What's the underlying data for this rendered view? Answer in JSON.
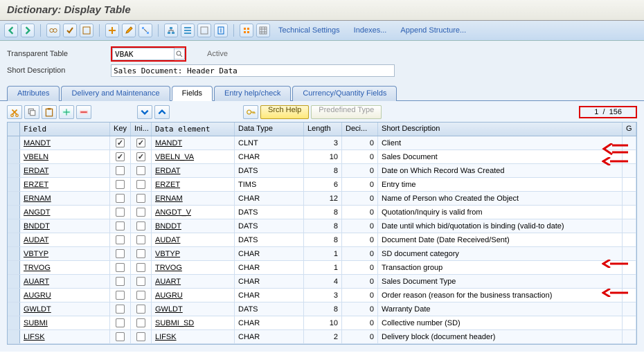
{
  "titlebar": "Dictionary: Display Table",
  "toolbar": {
    "tech_settings": "Technical Settings",
    "indexes": "Indexes...",
    "append": "Append Structure..."
  },
  "form": {
    "table_label": "Transparent Table",
    "table_value": "VBAK",
    "status": "Active",
    "desc_label": "Short Description",
    "desc_value": "Sales Document: Header Data"
  },
  "tabs": {
    "attributes": "Attributes",
    "delivery": "Delivery and Maintenance",
    "fields": "Fields",
    "entry": "Entry help/check",
    "currency": "Currency/Quantity Fields"
  },
  "gridbar": {
    "srch": "Srch Help",
    "pred": "Predefined Type",
    "page_cur": "1",
    "page_sep": "/",
    "page_total": "156"
  },
  "headers": {
    "field": "Field",
    "key": "Key",
    "ini": "Ini...",
    "de": "Data element",
    "dt": "Data Type",
    "len": "Length",
    "dec": "Deci...",
    "desc": "Short Description",
    "g": "G"
  },
  "rows": [
    {
      "field": "MANDT",
      "key": true,
      "ini": true,
      "de": "MANDT",
      "dt": "CLNT",
      "len": "3",
      "dec": "0",
      "desc": "Client"
    },
    {
      "field": "VBELN",
      "key": true,
      "ini": true,
      "de": "VBELN_VA",
      "dt": "CHAR",
      "len": "10",
      "dec": "0",
      "desc": "Sales Document"
    },
    {
      "field": "ERDAT",
      "key": false,
      "ini": false,
      "de": "ERDAT",
      "dt": "DATS",
      "len": "8",
      "dec": "0",
      "desc": "Date on Which Record Was Created"
    },
    {
      "field": "ERZET",
      "key": false,
      "ini": false,
      "de": "ERZET",
      "dt": "TIMS",
      "len": "6",
      "dec": "0",
      "desc": "Entry time"
    },
    {
      "field": "ERNAM",
      "key": false,
      "ini": false,
      "de": "ERNAM",
      "dt": "CHAR",
      "len": "12",
      "dec": "0",
      "desc": "Name of Person who Created the Object"
    },
    {
      "field": "ANGDT",
      "key": false,
      "ini": false,
      "de": "ANGDT_V",
      "dt": "DATS",
      "len": "8",
      "dec": "0",
      "desc": "Quotation/Inquiry is valid from"
    },
    {
      "field": "BNDDT",
      "key": false,
      "ini": false,
      "de": "BNDDT",
      "dt": "DATS",
      "len": "8",
      "dec": "0",
      "desc": "Date until which bid/quotation is binding (valid-to date)"
    },
    {
      "field": "AUDAT",
      "key": false,
      "ini": false,
      "de": "AUDAT",
      "dt": "DATS",
      "len": "8",
      "dec": "0",
      "desc": "Document Date (Date Received/Sent)"
    },
    {
      "field": "VBTYP",
      "key": false,
      "ini": false,
      "de": "VBTYP",
      "dt": "CHAR",
      "len": "1",
      "dec": "0",
      "desc": "SD document category"
    },
    {
      "field": "TRVOG",
      "key": false,
      "ini": false,
      "de": "TRVOG",
      "dt": "CHAR",
      "len": "1",
      "dec": "0",
      "desc": "Transaction group"
    },
    {
      "field": "AUART",
      "key": false,
      "ini": false,
      "de": "AUART",
      "dt": "CHAR",
      "len": "4",
      "dec": "0",
      "desc": "Sales Document Type"
    },
    {
      "field": "AUGRU",
      "key": false,
      "ini": false,
      "de": "AUGRU",
      "dt": "CHAR",
      "len": "3",
      "dec": "0",
      "desc": "Order reason (reason for the business transaction)"
    },
    {
      "field": "GWLDT",
      "key": false,
      "ini": false,
      "de": "GWLDT",
      "dt": "DATS",
      "len": "8",
      "dec": "0",
      "desc": "Warranty Date"
    },
    {
      "field": "SUBMI",
      "key": false,
      "ini": false,
      "de": "SUBMI_SD",
      "dt": "CHAR",
      "len": "10",
      "dec": "0",
      "desc": "Collective number (SD)"
    },
    {
      "field": "LIFSK",
      "key": false,
      "ini": false,
      "de": "LIFSK",
      "dt": "CHAR",
      "len": "2",
      "dec": "0",
      "desc": "Delivery block (document header)"
    }
  ]
}
